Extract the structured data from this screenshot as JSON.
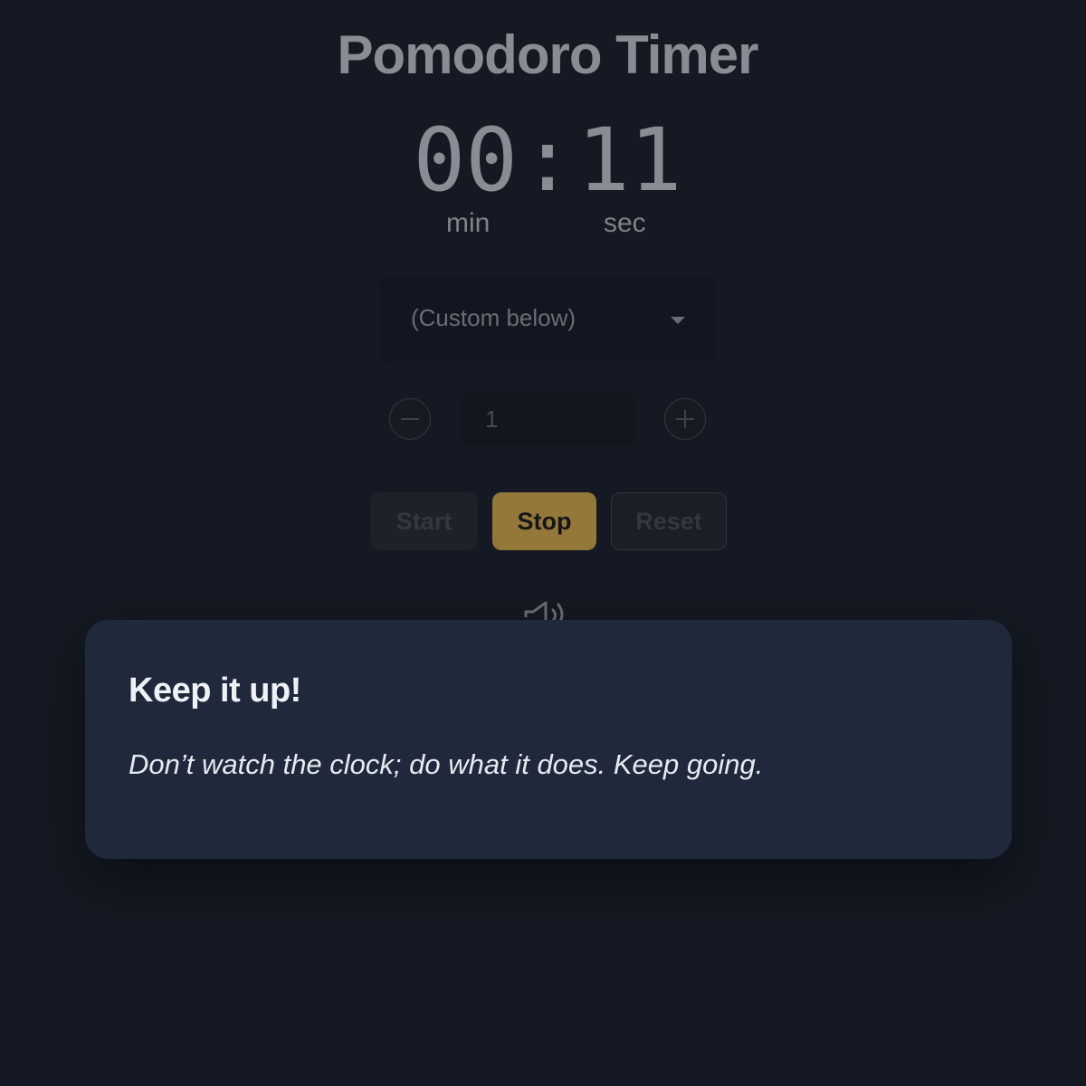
{
  "app": {
    "title": "Pomodoro Timer"
  },
  "timer": {
    "minutes": "00",
    "separator": ":",
    "seconds": "11",
    "minutes_unit": "min",
    "seconds_unit": "sec"
  },
  "preset": {
    "selected": "(Custom below)"
  },
  "custom_minutes": {
    "value": "1"
  },
  "controls": {
    "start_label": "Start",
    "stop_label": "Stop",
    "reset_label": "Reset",
    "stop_color": "#93783a"
  },
  "icons": {
    "decrement": "minus-circle-icon",
    "increment": "plus-circle-icon",
    "sound": "speaker-icon",
    "dropdown": "chevron-down-icon"
  },
  "modal": {
    "title": "Keep it up!",
    "message": "Don’t watch the clock; do what it does. Keep going."
  }
}
